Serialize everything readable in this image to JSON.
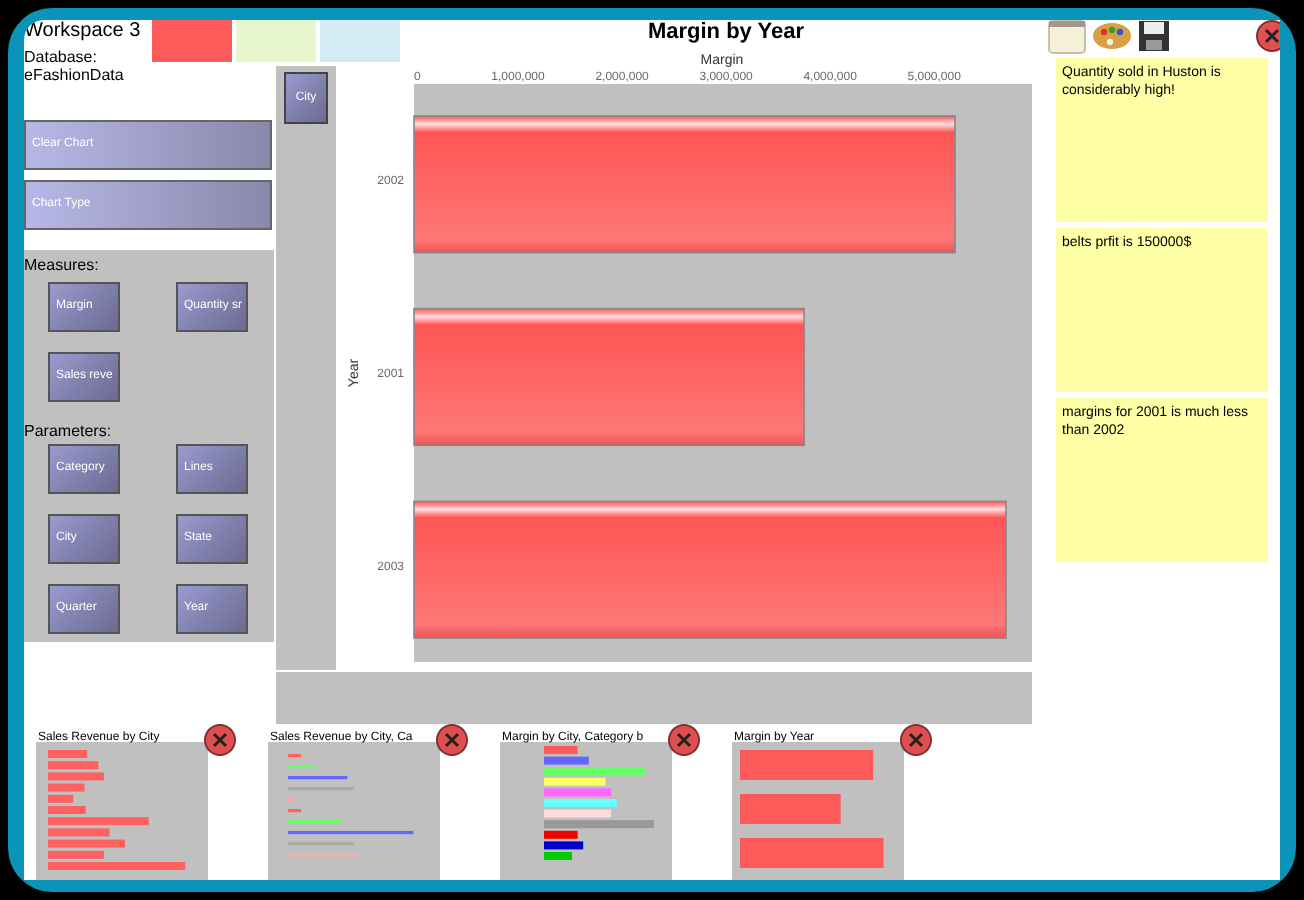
{
  "workspace": {
    "title": "Workspace 3",
    "database_label": "Database:",
    "database_name": "eFashionData"
  },
  "swatches": [
    {
      "color": "#ff5a5a"
    },
    {
      "color": "#e6f5cc"
    },
    {
      "color": "#d3ebf2"
    }
  ],
  "actions": [
    "Clear Chart",
    "Chart Type"
  ],
  "measures": {
    "label": "Measures:",
    "items": [
      "Margin",
      "Quantity sr",
      "Sales reve"
    ]
  },
  "parameters": {
    "label": "Parameters:",
    "items": [
      "Category",
      "Lines",
      "City",
      "State",
      "Quarter",
      "Year"
    ]
  },
  "filter_column": {
    "items": [
      "City"
    ]
  },
  "chart": {
    "chart_data": {
      "type": "bar",
      "orientation": "horizontal",
      "title": "Margin by Year",
      "xlabel": "Margin",
      "ylabel": "Year",
      "categories": [
        "2002",
        "2001",
        "2003"
      ],
      "values": [
        5200000,
        3750000,
        5690000
      ],
      "xlim": [
        0,
        5940000
      ],
      "xticks": [
        {
          "value": 0,
          "label": "0"
        },
        {
          "value": 1000000,
          "label": "1,000,000"
        },
        {
          "value": 2000000,
          "label": "2,000,000"
        },
        {
          "value": 3000000,
          "label": "3,000,000"
        },
        {
          "value": 4000000,
          "label": "4,000,000"
        },
        {
          "value": 5000000,
          "label": "5,000,000"
        }
      ]
    }
  },
  "notes": [
    "Quantity sold in Huston is considerably high!",
    "belts prfit is 150000$",
    "margins for 2001 is much less than 2002"
  ],
  "thumbnails": [
    {
      "title": "Sales Revenue by City"
    },
    {
      "title": "Sales Revenue by City, Ca"
    },
    {
      "title": "Margin by City, Category b"
    },
    {
      "title": "Margin by Year"
    }
  ]
}
